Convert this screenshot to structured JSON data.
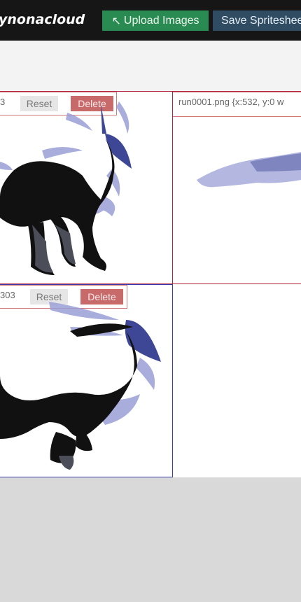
{
  "header": {
    "brand": "ynonacloud",
    "upload_icon": "arrow-up-left-icon",
    "upload_glyph": "↖",
    "upload_label": "Upload Images",
    "save_label": "Save Spritesheet"
  },
  "frames": [
    {
      "name": "3",
      "reset_label": "Reset",
      "delete_label": "Delete"
    },
    {
      "name": "run0001.png {x:532, y:0 w"
    },
    {
      "name": "303",
      "reset_label": "Reset",
      "delete_label": "Delete"
    }
  ],
  "colors": {
    "topbar": "#161616",
    "upload": "#2a8b52",
    "save": "#2f4c63",
    "delete": "#c96a6a",
    "frame_red": "#b2223a",
    "frame_blue": "#3b3bb0",
    "sprite_navy": "#3e4796",
    "sprite_lavender": "#9b9fd6"
  }
}
